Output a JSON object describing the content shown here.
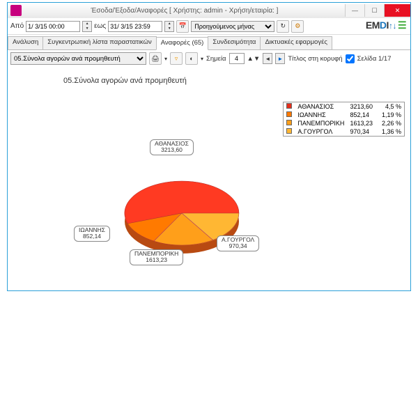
{
  "window": {
    "title": "Έσοδα/Έξοδα/Αναφορές   [ Χρήστης: admin - Χρήση/εταιρία:               ]"
  },
  "toolbar1": {
    "fromLabel": "Από",
    "fromValue": "1/ 3/15 00:00",
    "toLabel": "εως",
    "toValue": "31/ 3/15 23:59",
    "periodSelected": "Προηγούμενος μήνας"
  },
  "logoText": "EMDI",
  "tabs": [
    {
      "label": "Ανάλυση"
    },
    {
      "label": "Συγκεντρωτική λίστα παραστατικών"
    },
    {
      "label": "Αναφορές (65)",
      "active": true
    },
    {
      "label": "Συνδεσιμότητα"
    },
    {
      "label": "Δικτυακές εφαρμογές"
    }
  ],
  "toolbar2": {
    "reportSelected": "05.Σύνολα αγορών ανά προμηθευτή",
    "pointsLabel": "Σημεία",
    "pointsValue": "4",
    "titleTopLabel": "Τίτλος στη κορυφή",
    "titleTopChecked": true,
    "pageLabel": "Σελίδα 1/17"
  },
  "chartTitle": "05.Σύνολα αγορών ανά προμηθευτή",
  "legend": [
    {
      "name": "ΑΘΑΝΑΣΙΟΣ",
      "value": "3213,60",
      "pct": "4,5 %",
      "color": "#e62e1b"
    },
    {
      "name": "ΙΩΑΝΝΗΣ",
      "value": "852,14",
      "pct": "1,19 %",
      "color": "#ff7a00"
    },
    {
      "name": "ΠΑΝΕΜΠΟΡΙΚΗ",
      "value": "1613,23",
      "pct": "2,26 %",
      "color": "#ff9f1a"
    },
    {
      "name": "Α.ΓΟΥΡΓΟΛ",
      "value": "970,34",
      "pct": "1,36 %",
      "color": "#ffb733"
    }
  ],
  "slices": [
    {
      "name": "ΑΘΑΝΑΣΙΟΣ",
      "value": "3213,60"
    },
    {
      "name": "ΙΩΑΝΝΗΣ",
      "value": "852,14"
    },
    {
      "name": "ΠΑΝΕΜΠΟΡΙΚΗ",
      "value": "1613,23"
    },
    {
      "name": "Α.ΓΟΥΡΓΟΛ",
      "value": "970,34"
    }
  ],
  "chart_data": {
    "type": "pie",
    "title": "05.Σύνολα αγορών ανά προμηθευτή",
    "series": [
      {
        "name": "ΑΘΑΝΑΣΙΟΣ",
        "value": 3213.6,
        "pct": 4.5,
        "color": "#e62e1b"
      },
      {
        "name": "ΙΩΑΝΝΗΣ",
        "value": 852.14,
        "pct": 1.19,
        "color": "#ff7a00"
      },
      {
        "name": "ΠΑΝΕΜΠΟΡΙΚΗ",
        "value": 1613.23,
        "pct": 2.26,
        "color": "#ff9f1a"
      },
      {
        "name": "Α.ΓΟΥΡΓΟΛ",
        "value": 970.34,
        "pct": 1.36,
        "color": "#ffb733"
      }
    ]
  }
}
